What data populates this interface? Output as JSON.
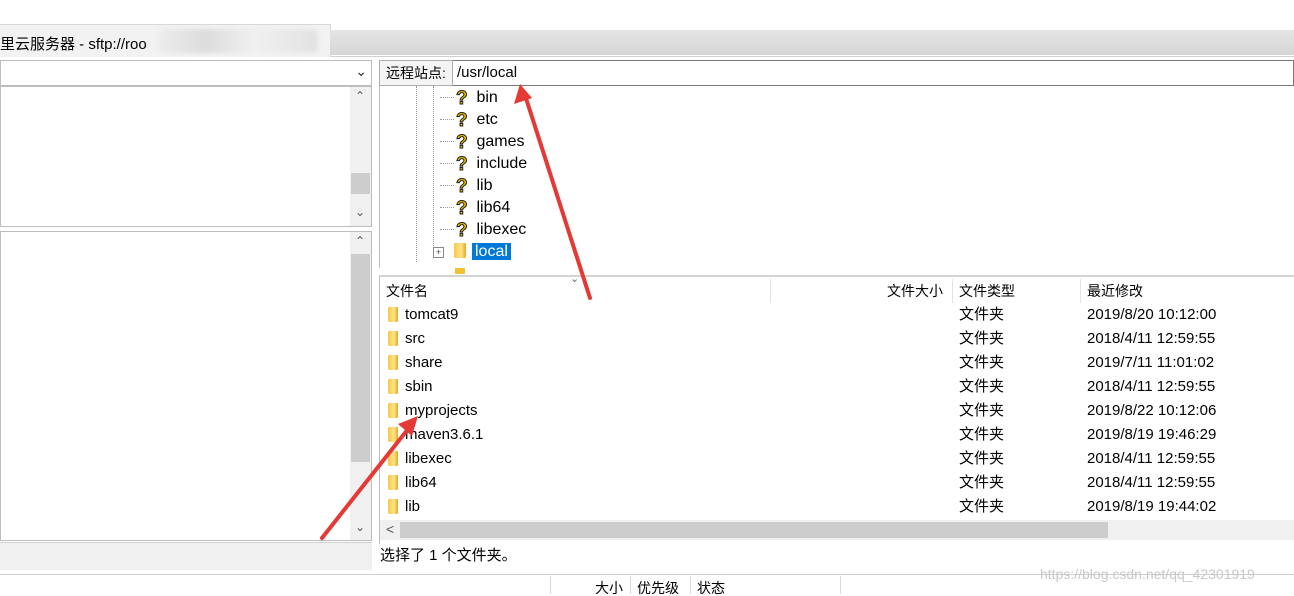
{
  "window": {
    "tab_title": "里云服务器 - sftp://roo"
  },
  "remote": {
    "label": "远程站点:",
    "path": "/usr/local"
  },
  "tree": {
    "items": [
      {
        "name": "bin",
        "icon": "question-icon"
      },
      {
        "name": "etc",
        "icon": "question-icon"
      },
      {
        "name": "games",
        "icon": "question-icon"
      },
      {
        "name": "include",
        "icon": "question-icon"
      },
      {
        "name": "lib",
        "icon": "question-icon"
      },
      {
        "name": "lib64",
        "icon": "question-icon"
      },
      {
        "name": "libexec",
        "icon": "question-icon"
      },
      {
        "name": "local",
        "icon": "folder-icon",
        "selected": true
      }
    ]
  },
  "filelist": {
    "columns": [
      "文件名",
      "文件大小",
      "文件类型",
      "最近修改"
    ],
    "rows": [
      {
        "name": "tomcat9",
        "size": "",
        "type": "文件夹",
        "modified": "2019/8/20 10:12:00"
      },
      {
        "name": "src",
        "size": "",
        "type": "文件夹",
        "modified": "2018/4/11 12:59:55"
      },
      {
        "name": "share",
        "size": "",
        "type": "文件夹",
        "modified": "2019/7/11 11:01:02"
      },
      {
        "name": "sbin",
        "size": "",
        "type": "文件夹",
        "modified": "2018/4/11 12:59:55"
      },
      {
        "name": "myprojects",
        "size": "",
        "type": "文件夹",
        "modified": "2019/8/22 10:12:06"
      },
      {
        "name": "maven3.6.1",
        "size": "",
        "type": "文件夹",
        "modified": "2019/8/19 19:46:29"
      },
      {
        "name": "libexec",
        "size": "",
        "type": "文件夹",
        "modified": "2018/4/11 12:59:55"
      },
      {
        "name": "lib64",
        "size": "",
        "type": "文件夹",
        "modified": "2018/4/11 12:59:55"
      },
      {
        "name": "lib",
        "size": "",
        "type": "文件夹",
        "modified": "2019/8/19 19:44:02"
      }
    ]
  },
  "status": {
    "remote": "选择了 1 个文件夹。"
  },
  "queue": {
    "columns": [
      "大小",
      "优先级",
      "状态"
    ]
  },
  "watermark": "https://blog.csdn.net/qq_42301919",
  "colors": {
    "selection": "#0078d7",
    "annotation_arrow": "#e53935",
    "folder": "#f7c948"
  }
}
